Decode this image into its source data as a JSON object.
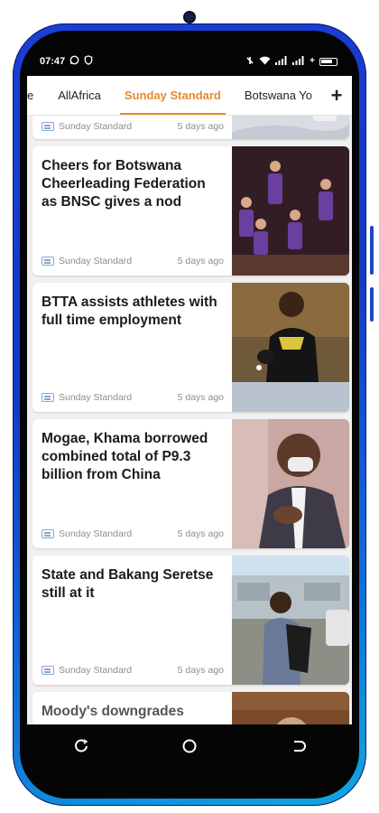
{
  "status_bar": {
    "time": "07:47",
    "battery": ""
  },
  "tabs": [
    {
      "label": "e"
    },
    {
      "label": "AllAfrica"
    },
    {
      "label": "Sunday Standard"
    },
    {
      "label": "Botswana Yo"
    }
  ],
  "add_tab_label": "+",
  "articles": [
    {
      "headline": "",
      "source": "Sunday Standard",
      "time": "5 days ago"
    },
    {
      "headline": "Cheers for Botswana Cheerleading Federation as BNSC gives a nod",
      "source": "Sunday Standard",
      "time": "5 days ago"
    },
    {
      "headline": "BTTA assists athletes with full time employment",
      "source": "Sunday Standard",
      "time": "5 days ago"
    },
    {
      "headline": "Mogae, Khama borrowed combined total of P9.3 billion from China",
      "source": "Sunday Standard",
      "time": "5 days ago"
    },
    {
      "headline": "State and Bakang Seretse still at it",
      "source": "Sunday Standard",
      "time": "5 days ago"
    },
    {
      "headline": "Moody's downgrades",
      "source": "",
      "time": ""
    }
  ],
  "colors": {
    "accent": "#e8892d",
    "frame_blue": "#1438c8",
    "screen_bg": "#f1f1f1"
  },
  "icons": {
    "nav_recent": "recent-apps-icon",
    "nav_home": "home-icon",
    "nav_back": "back-icon",
    "source": "newspaper-icon"
  }
}
